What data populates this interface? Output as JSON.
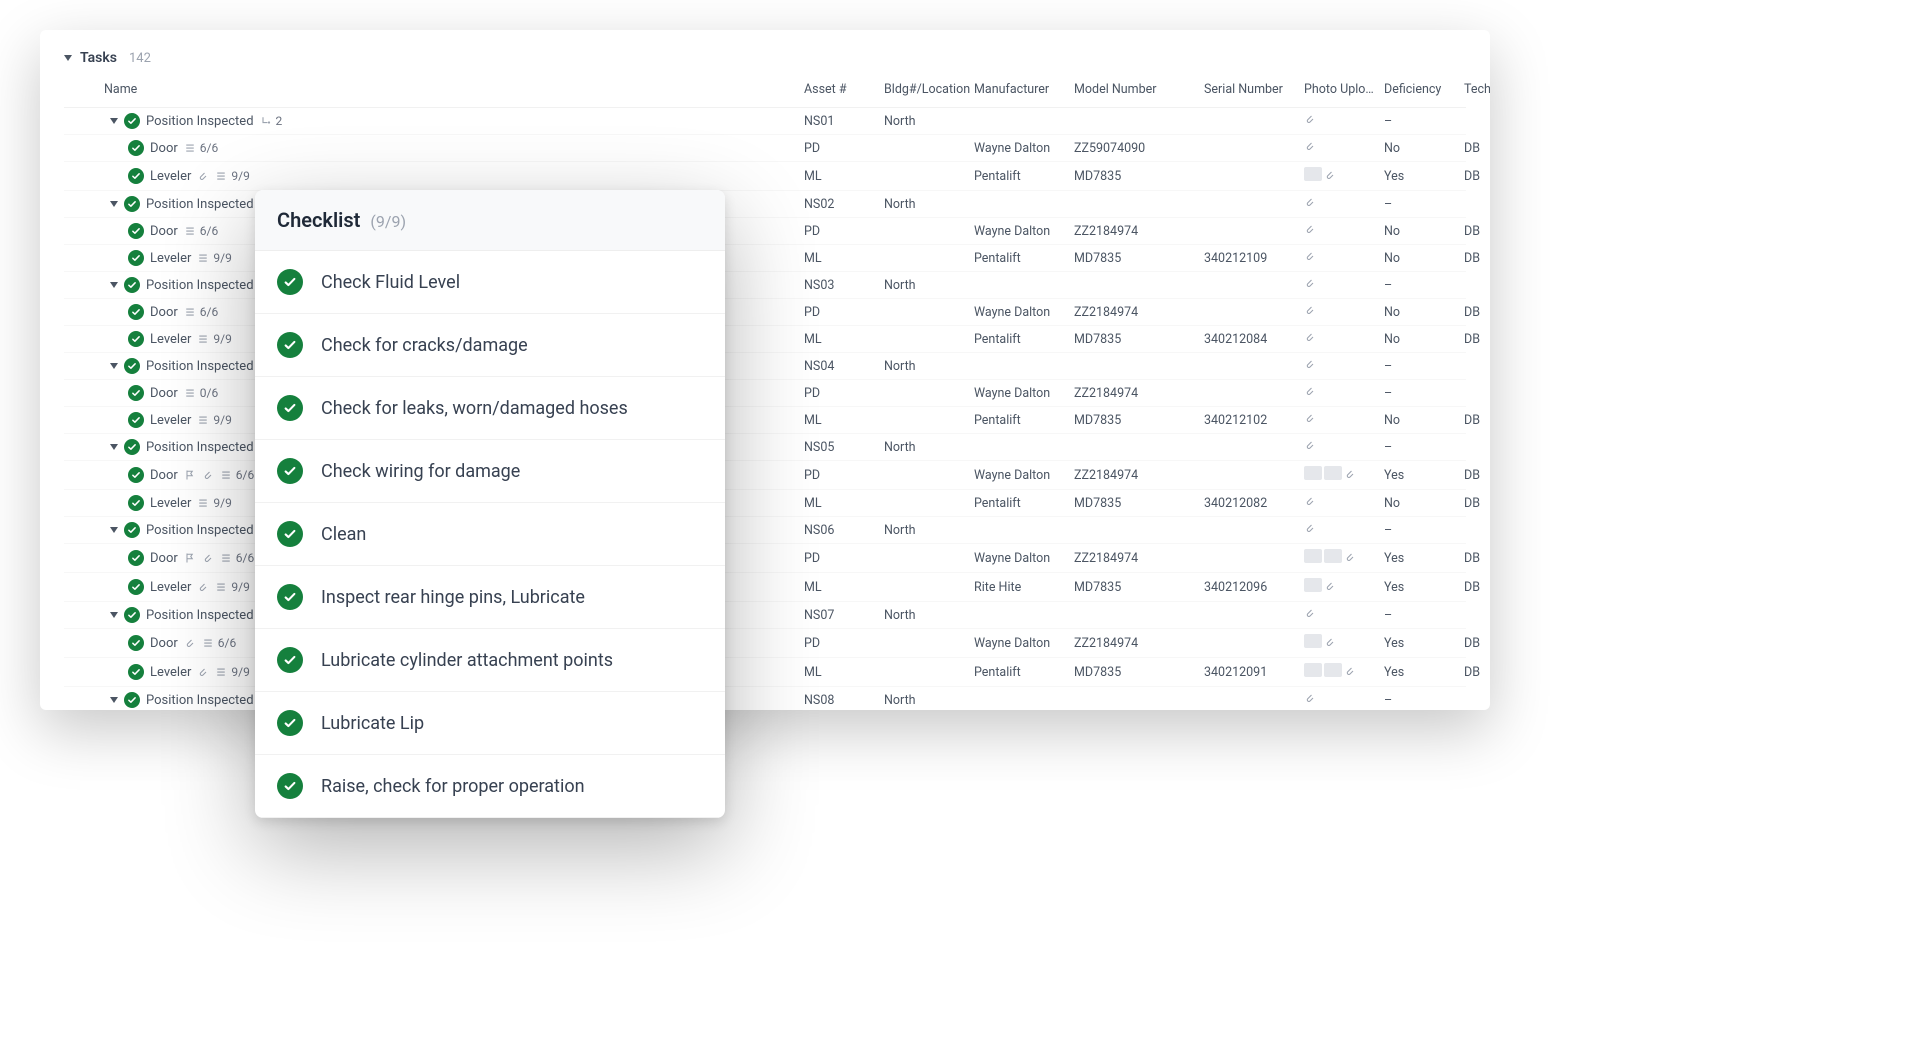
{
  "section": {
    "title": "Tasks",
    "count": "142"
  },
  "columns": [
    "Name",
    "Asset #",
    "Bldg#/Location",
    "Manufacturer",
    "Model Number",
    "Serial Number",
    "Photo Uplo…",
    "Deficiency",
    "Tech Initials"
  ],
  "groupName": "Position Inspected",
  "groupSub": "2",
  "rows": [
    {
      "type": "group",
      "asset": "NS01",
      "loc": "North",
      "def": "–",
      "atch": true
    },
    {
      "type": "child",
      "name": "Door",
      "ratio": "6/6",
      "asset": "PD",
      "mfr": "Wayne Dalton",
      "model": "ZZ59074090",
      "def": "No",
      "tech": "DB",
      "atch": true
    },
    {
      "type": "child",
      "name": "Leveler",
      "ratio": "9/9",
      "asset": "ML",
      "mfr": "Pentalift",
      "model": "MD7835",
      "def": "Yes",
      "tech": "DB",
      "thumbs": 1,
      "clip": true,
      "atch": true
    },
    {
      "type": "group",
      "asset": "NS02",
      "loc": "North",
      "def": "–",
      "atch": true
    },
    {
      "type": "child",
      "name": "Door",
      "ratio": "6/6",
      "asset": "PD",
      "mfr": "Wayne Dalton",
      "model": "ZZ2184974",
      "def": "No",
      "tech": "DB",
      "atch": true
    },
    {
      "type": "child",
      "name": "Leveler",
      "ratio": "9/9",
      "asset": "ML",
      "mfr": "Pentalift",
      "model": "MD7835",
      "serial": "340212109",
      "def": "No",
      "tech": "DB",
      "atch": true
    },
    {
      "type": "group",
      "asset": "NS03",
      "loc": "North",
      "def": "–",
      "atch": true
    },
    {
      "type": "child",
      "name": "Door",
      "ratio": "6/6",
      "asset": "PD",
      "mfr": "Wayne Dalton",
      "model": "ZZ2184974",
      "def": "No",
      "tech": "DB",
      "atch": true
    },
    {
      "type": "child",
      "name": "Leveler",
      "ratio": "9/9",
      "asset": "ML",
      "mfr": "Pentalift",
      "model": "MD7835",
      "serial": "340212084",
      "def": "No",
      "tech": "DB",
      "atch": true
    },
    {
      "type": "group",
      "asset": "NS04",
      "loc": "North",
      "def": "–",
      "atch": true
    },
    {
      "type": "child",
      "name": "Door",
      "ratio": "0/6",
      "asset": "PD",
      "mfr": "Wayne Dalton",
      "model": "ZZ2184974",
      "def": "–",
      "atch": true
    },
    {
      "type": "child",
      "name": "Leveler",
      "ratio": "9/9",
      "asset": "ML",
      "mfr": "Pentalift",
      "model": "MD7835",
      "serial": "340212102",
      "def": "No",
      "tech": "DB",
      "atch": true
    },
    {
      "type": "group",
      "asset": "NS05",
      "loc": "North",
      "def": "–",
      "atch": true
    },
    {
      "type": "child",
      "name": "Door",
      "ratio": "6/6",
      "asset": "PD",
      "mfr": "Wayne Dalton",
      "model": "ZZ2184974",
      "def": "Yes",
      "tech": "DB",
      "thumbs": 2,
      "clip": true,
      "atch": true,
      "extra": true
    },
    {
      "type": "child",
      "name": "Leveler",
      "ratio": "9/9",
      "asset": "ML",
      "mfr": "Pentalift",
      "model": "MD7835",
      "serial": "340212082",
      "def": "No",
      "tech": "DB",
      "atch": true
    },
    {
      "type": "group",
      "asset": "NS06",
      "loc": "North",
      "def": "–",
      "atch": true
    },
    {
      "type": "child",
      "name": "Door",
      "ratio": "6/6",
      "asset": "PD",
      "mfr": "Wayne Dalton",
      "model": "ZZ2184974",
      "def": "Yes",
      "tech": "DB",
      "thumbs": 2,
      "clip": true,
      "atch": true,
      "extra": true
    },
    {
      "type": "child",
      "name": "Leveler",
      "ratio": "9/9",
      "asset": "ML",
      "mfr": "Rite Hite",
      "model": "MD7835",
      "serial": "340212096",
      "def": "Yes",
      "tech": "DB",
      "thumbs": 1,
      "clip": true,
      "atch": true
    },
    {
      "type": "group",
      "asset": "NS07",
      "loc": "North",
      "def": "–",
      "atch": true,
      "extra": true
    },
    {
      "type": "child",
      "name": "Door",
      "ratio": "6/6",
      "asset": "PD",
      "mfr": "Wayne Dalton",
      "model": "ZZ2184974",
      "def": "Yes",
      "tech": "DB",
      "thumbs": 1,
      "clip": true,
      "atch": true
    },
    {
      "type": "child",
      "name": "Leveler",
      "ratio": "9/9",
      "asset": "ML",
      "mfr": "Pentalift",
      "model": "MD7835",
      "serial": "340212091",
      "def": "Yes",
      "tech": "DB",
      "thumbs": 2,
      "clip": true,
      "atch": true
    },
    {
      "type": "group",
      "asset": "NS08",
      "loc": "North",
      "def": "–",
      "atch": true
    }
  ],
  "checklist": {
    "title": "Checklist",
    "progress": "(9/9)",
    "items": [
      "Check Fluid Level",
      "Check for cracks/damage",
      "Check for leaks, worn/damaged hoses",
      "Check wiring for damage",
      "Clean",
      "Inspect rear hinge pins, Lubricate",
      "Lubricate cylinder attachment points",
      "Lubricate Lip",
      "Raise, check for proper operation"
    ]
  }
}
